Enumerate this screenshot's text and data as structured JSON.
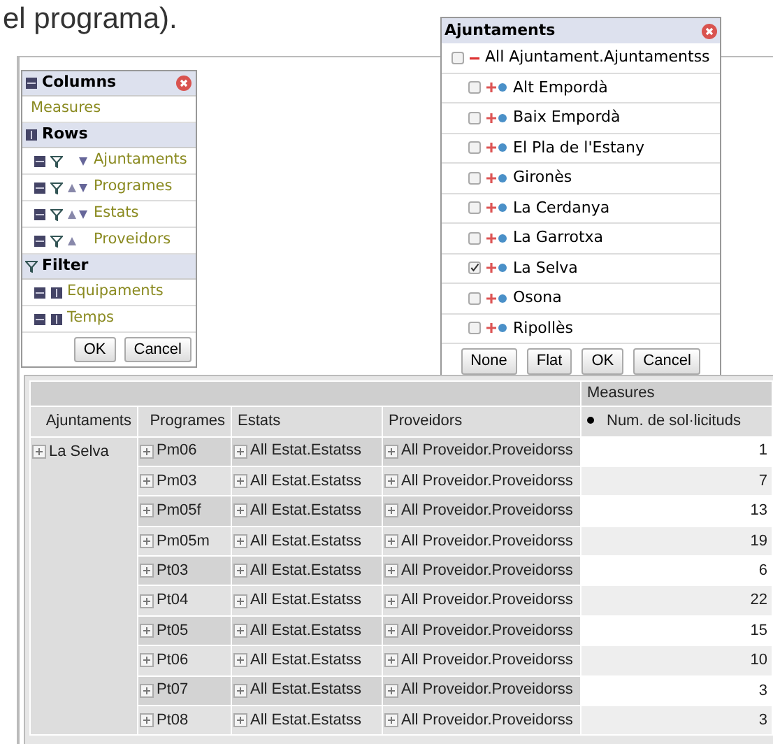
{
  "intro_text": "el programa).",
  "layout_panel": {
    "sections": [
      {
        "title": "Columns",
        "kind": "columns",
        "closable": true,
        "items": [
          {
            "label": "Measures",
            "kind": "plain"
          }
        ]
      },
      {
        "title": "Rows",
        "kind": "rows",
        "closable": false,
        "items": [
          {
            "label": "Ajuntaments",
            "kind": "axis",
            "sort_up": false,
            "sort_down": true
          },
          {
            "label": "Programes",
            "kind": "axis",
            "sort_up": true,
            "sort_down": true
          },
          {
            "label": "Estats",
            "kind": "axis",
            "sort_up": true,
            "sort_down": true
          },
          {
            "label": "Proveidors",
            "kind": "axis",
            "sort_up": true,
            "sort_down": false
          }
        ]
      },
      {
        "title": "Filter",
        "kind": "filter",
        "closable": false,
        "items": [
          {
            "label": "Equipaments",
            "kind": "filter"
          },
          {
            "label": "Temps",
            "kind": "filter"
          }
        ]
      }
    ],
    "buttons": [
      "OK",
      "Cancel"
    ]
  },
  "member_popup": {
    "title": "Ajuntaments",
    "root": {
      "label": "All Ajuntament.Ajuntamentss",
      "checked": false,
      "expanded": true
    },
    "members": [
      {
        "label": "Alt Empordà",
        "checked": false
      },
      {
        "label": "Baix Empordà",
        "checked": false
      },
      {
        "label": "El Pla de l'Estany",
        "checked": false
      },
      {
        "label": "Gironès",
        "checked": false
      },
      {
        "label": "La Cerdanya",
        "checked": false
      },
      {
        "label": "La Garrotxa",
        "checked": false
      },
      {
        "label": "La Selva",
        "checked": true
      },
      {
        "label": "Osona",
        "checked": false
      },
      {
        "label": "Ripollès",
        "checked": false
      }
    ],
    "buttons": [
      "None",
      "Flat",
      "OK",
      "Cancel"
    ]
  },
  "table": {
    "measures_header": "Measures",
    "columns": [
      "Ajuntaments",
      "Programes",
      "Estats",
      "Proveidors"
    ],
    "measure_column": "Num. de sol·licituds",
    "group": "La Selva",
    "rows": [
      {
        "programa": "Pm06",
        "estat": "All Estat.Estatss",
        "proveidor": "All Proveidor.Proveidorss",
        "value": "1"
      },
      {
        "programa": "Pm03",
        "estat": "All Estat.Estatss",
        "proveidor": "All Proveidor.Proveidorss",
        "value": "7"
      },
      {
        "programa": "Pm05f",
        "estat": "All Estat.Estatss",
        "proveidor": "All Proveidor.Proveidorss",
        "value": "13"
      },
      {
        "programa": "Pm05m",
        "estat": "All Estat.Estatss",
        "proveidor": "All Proveidor.Proveidorss",
        "value": "19"
      },
      {
        "programa": "Pt03",
        "estat": "All Estat.Estatss",
        "proveidor": "All Proveidor.Proveidorss",
        "value": "6"
      },
      {
        "programa": "Pt04",
        "estat": "All Estat.Estatss",
        "proveidor": "All Proveidor.Proveidorss",
        "value": "22"
      },
      {
        "programa": "Pt05",
        "estat": "All Estat.Estatss",
        "proveidor": "All Proveidor.Proveidorss",
        "value": "15"
      },
      {
        "programa": "Pt06",
        "estat": "All Estat.Estatss",
        "proveidor": "All Proveidor.Proveidorss",
        "value": "10"
      },
      {
        "programa": "Pt07",
        "estat": "All Estat.Estatss",
        "proveidor": "All Proveidor.Proveidorss",
        "value": "3"
      },
      {
        "programa": "Pt08",
        "estat": "All Estat.Estatss",
        "proveidor": "All Proveidor.Proveidorss",
        "value": "3"
      }
    ]
  }
}
